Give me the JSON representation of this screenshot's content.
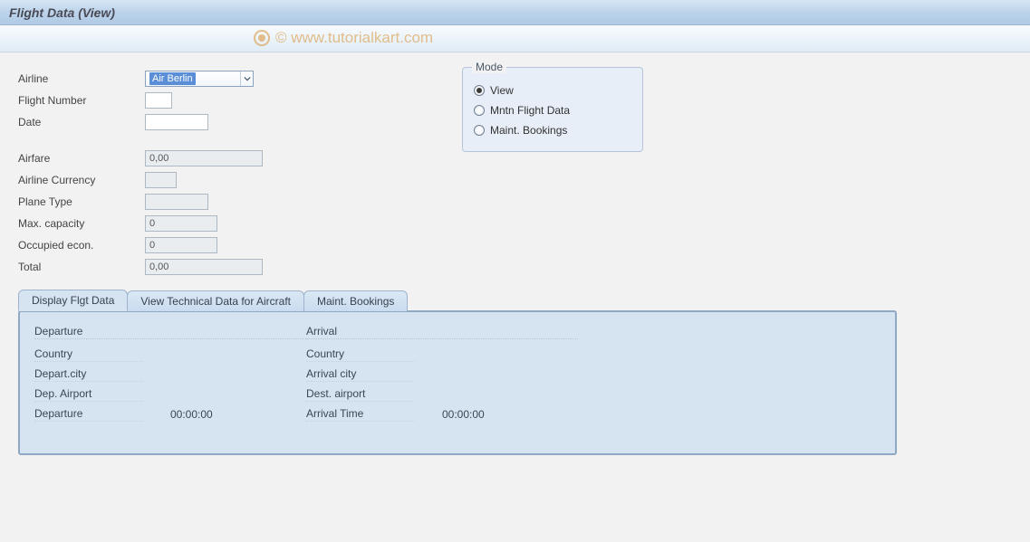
{
  "title": "Flight Data (View)",
  "watermark": "© www.tutorialkart.com",
  "form": {
    "airline_label": "Airline",
    "airline_value": "Air Berlin",
    "flight_number_label": "Flight Number",
    "flight_number_value": "",
    "date_label": "Date",
    "date_value": "",
    "airfare_label": "Airfare",
    "airfare_value": "0,00",
    "currency_label": "Airline Currency",
    "currency_value": "",
    "plane_type_label": "Plane Type",
    "plane_type_value": "",
    "max_capacity_label": "Max. capacity",
    "max_capacity_value": "0",
    "occupied_label": "Occupied econ.",
    "occupied_value": "0",
    "total_label": "Total",
    "total_value": "0,00"
  },
  "mode": {
    "title": "Mode",
    "options": [
      {
        "label": "View",
        "selected": true
      },
      {
        "label": "Mntn Flight Data",
        "selected": false
      },
      {
        "label": "Maint. Bookings",
        "selected": false
      }
    ]
  },
  "tabs": {
    "items": [
      {
        "label": "Display Flgt Data",
        "active": true
      },
      {
        "label": "View Technical Data for Aircraft",
        "active": false
      },
      {
        "label": "Maint. Bookings",
        "active": false
      }
    ]
  },
  "panel": {
    "departure": {
      "header": "Departure",
      "country_label": "Country",
      "city_label": "Depart.city",
      "airport_label": "Dep. Airport",
      "time_label": "Departure",
      "time_value": "00:00:00"
    },
    "arrival": {
      "header": "Arrival",
      "country_label": "Country",
      "city_label": "Arrival city",
      "airport_label": "Dest. airport",
      "time_label": "Arrival Time",
      "time_value": "00:00:00"
    }
  }
}
